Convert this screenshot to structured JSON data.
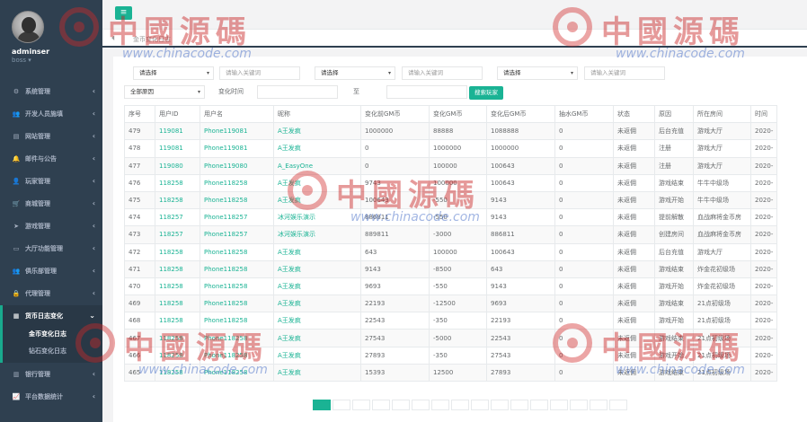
{
  "sidebar": {
    "username": "adminser",
    "role": "boss ▾",
    "items": [
      {
        "label": "系统管理",
        "icon": "gears-icon",
        "glyph": "⚙"
      },
      {
        "label": "开发人员施填",
        "icon": "users-icon",
        "glyph": "👥"
      },
      {
        "label": "网站管理",
        "icon": "globe-icon",
        "glyph": "▤"
      },
      {
        "label": "邮件与公告",
        "icon": "bell-icon",
        "glyph": "🔔"
      },
      {
        "label": "玩家管理",
        "icon": "user-icon",
        "glyph": "👤"
      },
      {
        "label": "商城管理",
        "icon": "cart-icon",
        "glyph": "🛒"
      },
      {
        "label": "游戏管理",
        "icon": "send-icon",
        "glyph": "➤"
      },
      {
        "label": "大厅功能管理",
        "icon": "desktop-icon",
        "glyph": "▭"
      },
      {
        "label": "俱乐部管理",
        "icon": "group-icon",
        "glyph": "👥"
      },
      {
        "label": "代理管理",
        "icon": "lock-icon",
        "glyph": "🔒"
      },
      {
        "label": "货币日志变化",
        "icon": "calendar-icon",
        "glyph": "▦"
      },
      {
        "label": "银行管理",
        "icon": "bank-icon",
        "glyph": "▥"
      },
      {
        "label": "平台数据统计",
        "icon": "chart-icon",
        "glyph": "📈"
      }
    ],
    "sub_items": [
      "金币变化日志",
      "钻石变化日志"
    ]
  },
  "topbar": {
    "menu_glyph": "≡"
  },
  "tabs": {
    "back_glyph": "⏴",
    "active": "金币变化日志"
  },
  "filters": {
    "select1": "请选择",
    "input1_placeholder": "请输入关键词",
    "select2": "请选择",
    "input2_placeholder": "请输入关键词",
    "select3": "请选择",
    "input3_placeholder": "请输入关键词",
    "reason_select": "全部原因",
    "time_label": "变化时间",
    "to_label": "至",
    "search_button": "搜索玩家"
  },
  "table": {
    "headers": [
      "序号",
      "用户ID",
      "用户名",
      "昵称",
      "变化前GM币",
      "变化GM币",
      "变化后GM币",
      "抽水GM币",
      "状态",
      "原因",
      "所在房间",
      "时间"
    ],
    "rows": [
      [
        "479",
        "119081",
        "Phone119081",
        "A王发疯",
        "1000000",
        "88888",
        "1088888",
        "0",
        "未返佣",
        "后台充值",
        "游戏大厅",
        "2020-"
      ],
      [
        "478",
        "119081",
        "Phone119081",
        "A王发疯",
        "0",
        "1000000",
        "1000000",
        "0",
        "未返佣",
        "注册",
        "游戏大厅",
        "2020-"
      ],
      [
        "477",
        "119080",
        "Phone119080",
        "A_EasyOne",
        "0",
        "100000",
        "100643",
        "0",
        "未返佣",
        "注册",
        "游戏大厅",
        "2020-"
      ],
      [
        "476",
        "118258",
        "Phone118258",
        "A王发疯",
        "9743",
        "100000",
        "100643",
        "0",
        "未返佣",
        "游戏结束",
        "牛牛中级场",
        "2020-"
      ],
      [
        "475",
        "118258",
        "Phone118258",
        "A王发疯",
        "100643",
        "-550",
        "9143",
        "0",
        "未返佣",
        "游戏开始",
        "牛牛中级场",
        "2020-"
      ],
      [
        "474",
        "118257",
        "Phone118257",
        "冰河娱乐演示",
        "886811",
        "-550",
        "9143",
        "0",
        "未返佣",
        "提前解散",
        "血战麻将金币房",
        "2020-"
      ],
      [
        "473",
        "118257",
        "Phone118257",
        "冰河娱乐演示",
        "889811",
        "-3000",
        "886811",
        "0",
        "未返佣",
        "创建房间",
        "血战麻将金币房",
        "2020-"
      ],
      [
        "472",
        "118258",
        "Phone118258",
        "A王发疯",
        "643",
        "100000",
        "100643",
        "0",
        "未返佣",
        "后台充值",
        "游戏大厅",
        "2020-"
      ],
      [
        "471",
        "118258",
        "Phone118258",
        "A王发疯",
        "9143",
        "-8500",
        "643",
        "0",
        "未返佣",
        "游戏结束",
        "炸金花初级场",
        "2020-"
      ],
      [
        "470",
        "118258",
        "Phone118258",
        "A王发疯",
        "9693",
        "-550",
        "9143",
        "0",
        "未返佣",
        "游戏开始",
        "炸金花初级场",
        "2020-"
      ],
      [
        "469",
        "118258",
        "Phone118258",
        "A王发疯",
        "22193",
        "-12500",
        "9693",
        "0",
        "未返佣",
        "游戏结束",
        "21点初级场",
        "2020-"
      ],
      [
        "468",
        "118258",
        "Phone118258",
        "A王发疯",
        "22543",
        "-350",
        "22193",
        "0",
        "未返佣",
        "游戏开始",
        "21点初级场",
        "2020-"
      ],
      [
        "467",
        "118258",
        "Phone118258",
        "A王发疯",
        "27543",
        "-5000",
        "22543",
        "0",
        "未返佣",
        "游戏结束",
        "21点初级场",
        "2020-"
      ],
      [
        "466",
        "118258",
        "Phone118258",
        "A王发疯",
        "27893",
        "-350",
        "27543",
        "0",
        "未返佣",
        "游戏开始",
        "21点初级场",
        "2020-"
      ],
      [
        "465",
        "118258",
        "Phone118258",
        "A王发疯",
        "15393",
        "12500",
        "27893",
        "0",
        "未返佣",
        "游戏结束",
        "21点初级场",
        "2020-"
      ]
    ]
  },
  "watermark": {
    "cn": "中國源碼",
    "url": "www.chinacode.com"
  },
  "colors": {
    "sidebar_bg": "#2f4050",
    "accent": "#1ab394",
    "link": "#1ab394"
  }
}
